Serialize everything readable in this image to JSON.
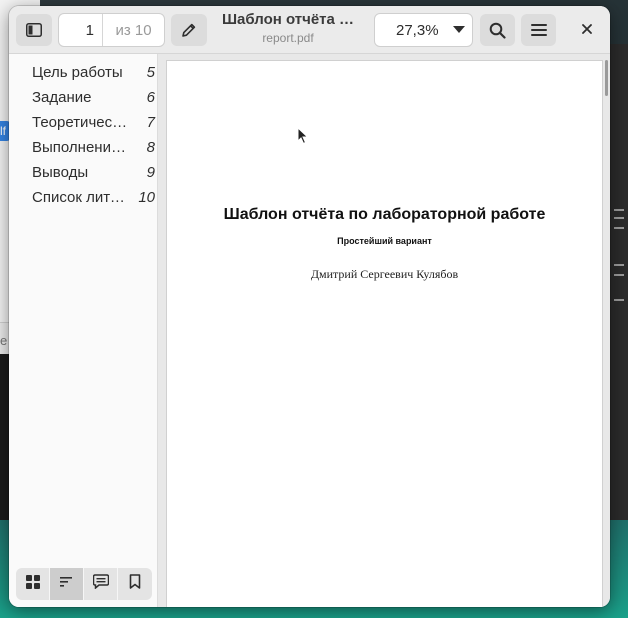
{
  "background": {
    "left_fragment_text": "е",
    "badge_text": "lf"
  },
  "header": {
    "page_current": "1",
    "page_total": "из 10",
    "title": "Шаблон отчёта …",
    "filename": "report.pdf",
    "zoom": "27,3%"
  },
  "sidebar": {
    "outline": [
      {
        "label": "Цель работы",
        "page": "5"
      },
      {
        "label": "Задание",
        "page": "6"
      },
      {
        "label": "Теоретичес…",
        "page": "7"
      },
      {
        "label": "Выполнение…",
        "page": "8"
      },
      {
        "label": "Выводы",
        "page": "9"
      },
      {
        "label": "Список лите…",
        "page": "10"
      }
    ],
    "switcher": [
      {
        "icon": "thumbnails-grid-icon",
        "active": false
      },
      {
        "icon": "outline-list-icon",
        "active": true
      },
      {
        "icon": "annotations-icon",
        "active": false
      },
      {
        "icon": "bookmark-icon",
        "active": false
      }
    ]
  },
  "document": {
    "title": "Шаблон отчёта по лабораторной работе",
    "subtitle": "Простейший вариант",
    "author": "Дмитрий Сергеевич Кулябов"
  },
  "colors": {
    "headerbar": "#ebebeb",
    "button": "#dcdcdc",
    "sidebar_active_tab": "#cdcdcd",
    "document_bg": "#e8e8e8",
    "page_bg": "#ffffff"
  }
}
